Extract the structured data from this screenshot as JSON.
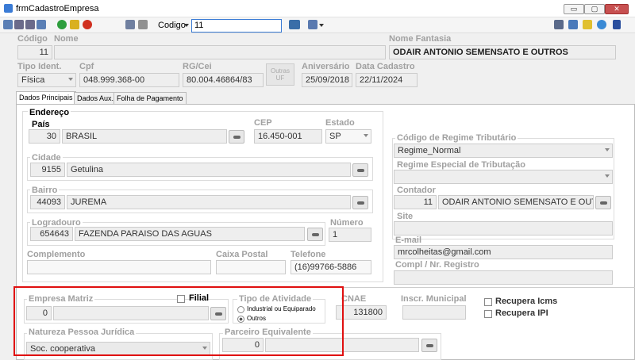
{
  "window": {
    "title": "frmCadastroEmpresa",
    "minimize": "▭",
    "maximize": "▢",
    "close": "✕"
  },
  "toolbar": {
    "search_label": "Codigo",
    "search_value": "11"
  },
  "header": {
    "codigo_label": "Código",
    "codigo_value": "11",
    "nome_label": "Nome",
    "nome_value": "",
    "fantasia_label": "Nome Fantasia",
    "fantasia_value": "ODAIR ANTONIO SEMENSATO E OUTROS",
    "tipo_label": "Tipo Ident.",
    "tipo_value": "Física",
    "cpf_label": "Cpf",
    "cpf_value": "048.999.368-00",
    "rg_label": "RG/Cei",
    "rg_value": "80.004.46864/83",
    "outras_uf": "Outras UF",
    "aniv_label": "Aniversário",
    "aniv_value": "25/09/2018",
    "data_label": "Data Cadastro",
    "data_value": "22/11/2024"
  },
  "tabs": [
    "Dados Principais",
    "Dados Aux.",
    "Folha de Pagamento"
  ],
  "endereco": {
    "title": "Endereço",
    "pais_label": "País",
    "pais_code": "30",
    "pais_name": "BRASIL",
    "cep_label": "CEP",
    "cep_value": "16.450-001",
    "estado_label": "Estado",
    "estado_value": "SP",
    "cidade_label": "Cidade",
    "cidade_code": "9155",
    "cidade_name": "Getulina",
    "bairro_label": "Bairro",
    "bairro_code": "44093",
    "bairro_name": "JUREMA",
    "logr_label": "Logradouro",
    "logr_code": "654643",
    "logr_name": "FAZENDA PARAISO DAS AGUAS",
    "numero_label": "Número",
    "numero_value": "1",
    "compl_label": "Complemento",
    "caixa_label": "Caixa Postal",
    "tel_label": "Telefone",
    "tel_value": "(16)99766-5886"
  },
  "right": {
    "regime_label": "Código de Regime Tributário",
    "regime_value": "Regime_Normal",
    "especial_label": "Regime Especial de Tributação",
    "contador_label": "Contador",
    "contador_code": "11",
    "contador_name": "ODAIR ANTONIO SEMENSATO E OUTRO",
    "site_label": "Site",
    "email_label": "E-mail",
    "email_value": "mrcolheitas@gmail.com",
    "compl_label": "Compl / Nr. Registro"
  },
  "bottom": {
    "matriz_label": "Empresa Matriz",
    "matriz_value": "0",
    "filial_label": "Filial",
    "atividade_label": "Tipo de Atividade",
    "opt1": "Industrial ou Equiparado",
    "opt2": "Outros",
    "cnae_label": "CNAE",
    "cnae_value": "131800",
    "inscr_label": "Inscr. Municipal",
    "icms_label": "Recupera Icms",
    "ipi_label": "Recupera IPI",
    "natureza_label": "Natureza Pessoa Jurídica",
    "natureza_value": "Soc. cooperativa",
    "parceiro_label": "Parceiro Equivalente",
    "parceiro_value": "0"
  },
  "colors": {
    "highlight": "#e01010"
  }
}
